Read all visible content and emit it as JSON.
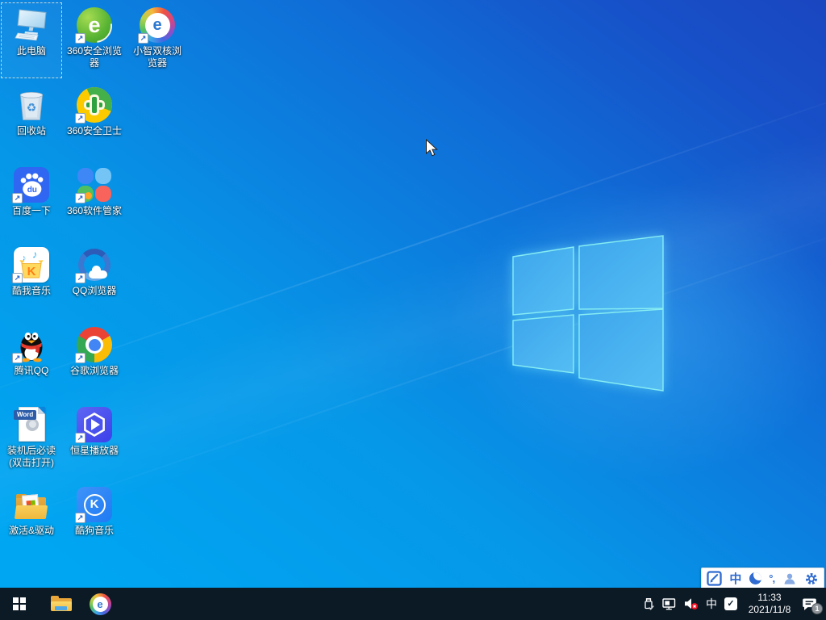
{
  "wallpaper": {
    "base_color": "#00a6f2",
    "deep_color": "#1a46c0"
  },
  "desktop": {
    "icons": [
      {
        "name": "this-pc",
        "label": "此电脑",
        "selected": true,
        "shortcut": false
      },
      {
        "name": "recycle-bin",
        "label": "回收站",
        "shortcut": false
      },
      {
        "name": "baidu-search",
        "label": "百度一下",
        "shortcut": true
      },
      {
        "name": "kuwo-music",
        "label": "酷我音乐",
        "shortcut": true
      },
      {
        "name": "tencent-qq",
        "label": "腾讯QQ",
        "shortcut": true
      },
      {
        "name": "post-install-readme",
        "label": "装机后必读(双击打开)",
        "badge": "Word",
        "shortcut": false
      },
      {
        "name": "activation-drivers",
        "label": "激活&驱动",
        "shortcut": false
      },
      {
        "name": "360-secure-browser",
        "label": "360安全浏览器",
        "shortcut": true
      },
      {
        "name": "360-safety-guard",
        "label": "360安全卫士",
        "shortcut": true
      },
      {
        "name": "360-software-manager",
        "label": "360软件管家",
        "shortcut": true
      },
      {
        "name": "qq-browser",
        "label": "QQ浏览器",
        "shortcut": true
      },
      {
        "name": "google-chrome",
        "label": "谷歌浏览器",
        "shortcut": true
      },
      {
        "name": "star-player",
        "label": "恒星播放器",
        "shortcut": true
      },
      {
        "name": "kugou-music",
        "label": "酷狗音乐",
        "shortcut": true
      },
      {
        "name": "xiaozhi-dual-core-browser",
        "label": "小智双核浏览器",
        "shortcut": true
      }
    ]
  },
  "taskbar": {
    "tray": {
      "ime_indicator": "中",
      "time": "11:33",
      "date": "2021/11/8",
      "notification_count": "1"
    }
  },
  "ime_bar": {
    "mode_indicator": "中",
    "punctuation_glyph": "°,"
  },
  "icon_glyphs": {
    "shortcut_arrow": "↗",
    "e_letter": "e",
    "k_letter": "K",
    "du_letters": "du",
    "word_badge": "Word",
    "recycle_symbol": "♻",
    "music_note": "♪",
    "check_mark": "✓"
  }
}
